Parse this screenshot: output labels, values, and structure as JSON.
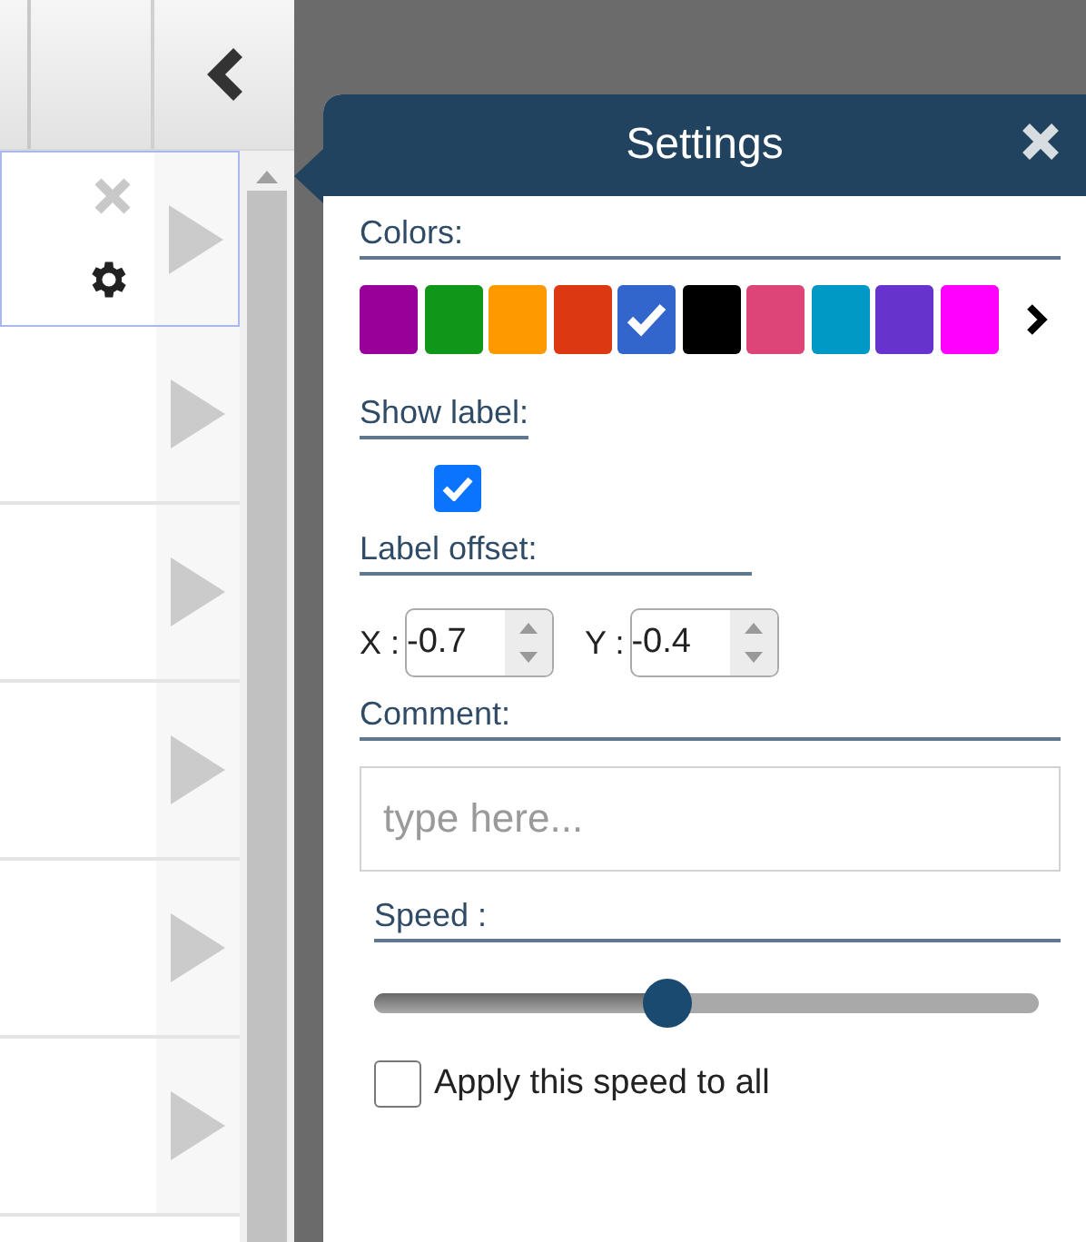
{
  "list": {
    "rows": [
      {
        "selected": true,
        "has_actions": true
      },
      {
        "selected": false,
        "has_actions": false
      },
      {
        "selected": false,
        "has_actions": false
      },
      {
        "selected": false,
        "has_actions": false
      },
      {
        "selected": false,
        "has_actions": false
      },
      {
        "selected": false,
        "has_actions": false
      }
    ]
  },
  "settings": {
    "title": "Settings",
    "colors_label": "Colors:",
    "colors": [
      {
        "color": "#990099",
        "selected": false
      },
      {
        "color": "#109618",
        "selected": false
      },
      {
        "color": "#ff9900",
        "selected": false
      },
      {
        "color": "#dc3912",
        "selected": false
      },
      {
        "color": "#3366cc",
        "selected": true
      },
      {
        "color": "#000000",
        "selected": false
      },
      {
        "color": "#dd4477",
        "selected": false
      },
      {
        "color": "#0099c6",
        "selected": false
      },
      {
        "color": "#6633cc",
        "selected": false
      },
      {
        "color": "#ff00ff",
        "selected": false
      }
    ],
    "show_label": {
      "label": "Show label:",
      "checked": true
    },
    "label_offset": {
      "label": "Label offset:",
      "x_label": "X :",
      "x_value": "-0.7",
      "y_label": "Y :",
      "y_value": "-0.4"
    },
    "comment": {
      "label": "Comment:",
      "placeholder": "type here..."
    },
    "speed": {
      "label": "Speed :",
      "level": 0.44
    },
    "apply_all": {
      "label": "Apply this speed to all",
      "checked": false
    }
  }
}
